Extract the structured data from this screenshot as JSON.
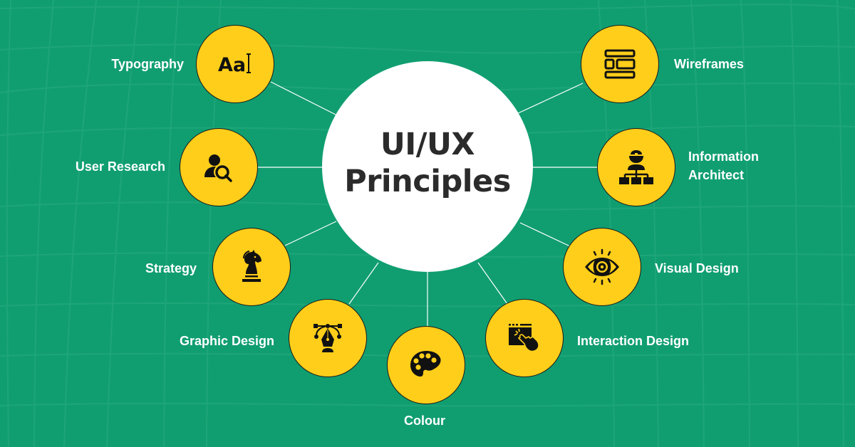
{
  "colors": {
    "background": "#109E70",
    "grid_line": "#2aab80",
    "node_fill": "#FFCE1A",
    "node_outline": "#1a1a1a",
    "center_fill": "#FFFFFF",
    "title_text": "#2B2B2B",
    "label_text": "#FFFFFF",
    "connector": "#FFFFFF"
  },
  "center": {
    "line1": "UI/UX",
    "line2": "Principles"
  },
  "nodes": [
    {
      "id": "typography",
      "label": "Typography",
      "icon": "typography-icon",
      "icon_text": "Aa"
    },
    {
      "id": "user-research",
      "label": "User Research",
      "icon": "user-search-icon"
    },
    {
      "id": "strategy",
      "label": "Strategy",
      "icon": "chess-knight-icon"
    },
    {
      "id": "graphic-design",
      "label": "Graphic Design",
      "icon": "pen-tool-icon"
    },
    {
      "id": "colour",
      "label": "Colour",
      "icon": "palette-icon"
    },
    {
      "id": "interaction-design",
      "label": "Interaction Design",
      "icon": "click-hand-icon"
    },
    {
      "id": "visual-design",
      "label": "Visual Design",
      "icon": "eye-icon"
    },
    {
      "id": "information-architect",
      "label_line1": "Information",
      "label_line2": "Architect",
      "icon": "hierarchy-person-icon"
    },
    {
      "id": "wireframes",
      "label": "Wireframes",
      "icon": "wireframe-layout-icon"
    }
  ]
}
